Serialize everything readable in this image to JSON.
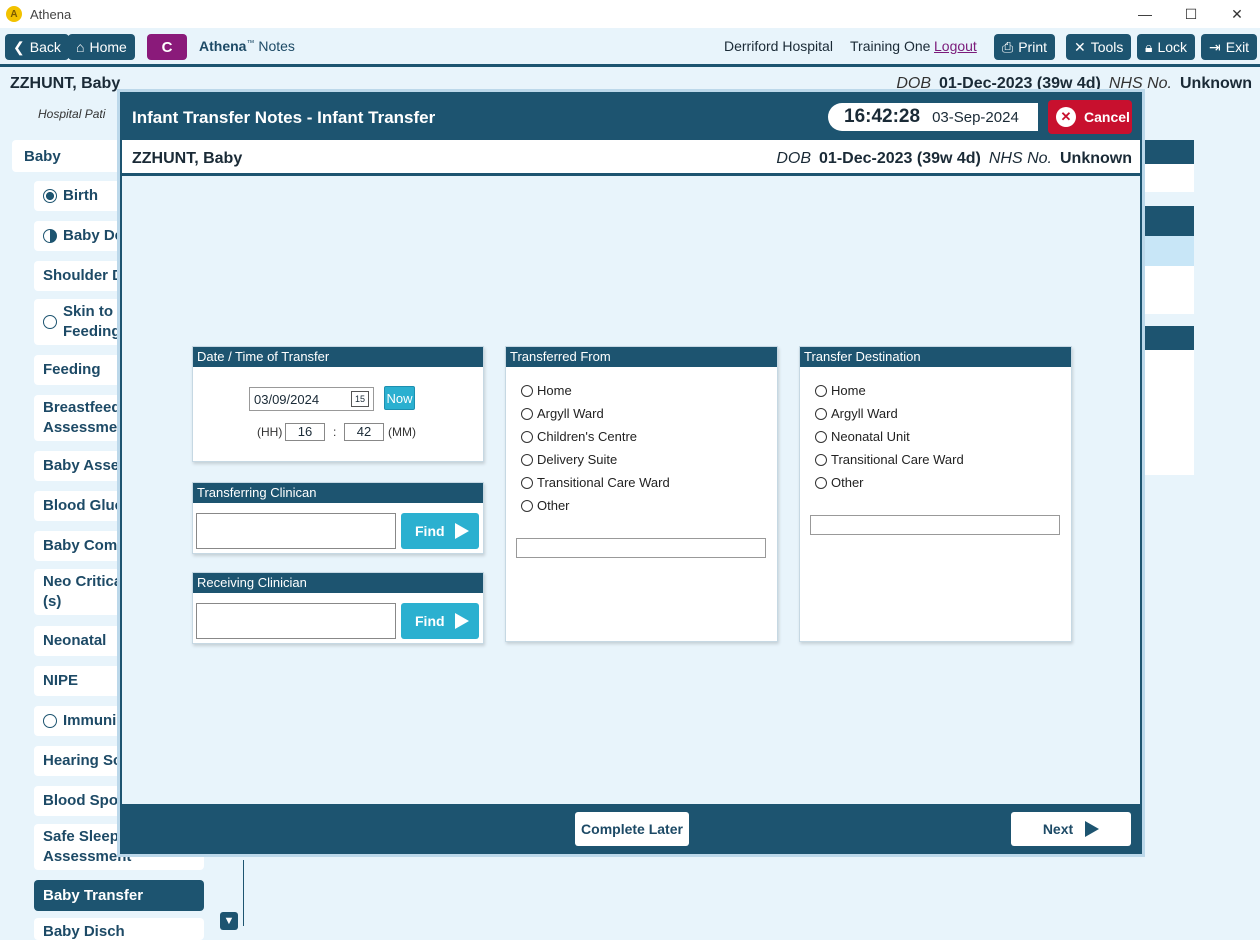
{
  "window": {
    "app_title": "Athena",
    "logo_letter": "A",
    "minimize": "—",
    "maximize": "☐",
    "close": "✕"
  },
  "toolbar": {
    "back": "Back",
    "home": "Home",
    "c_badge": "C",
    "brand": "Athena",
    "brand_tm": "™",
    "brand_suffix": " Notes",
    "hospital": "Derriford Hospital",
    "user": "Training One",
    "logout": "Logout",
    "print": "Print",
    "tools": "Tools",
    "lock": "Lock",
    "exit": "Exit"
  },
  "patient": {
    "name": "ZZHUNT, Baby",
    "dob_label": "DOB",
    "dob": "01-Dec-2023 (39w 4d)",
    "nhs_label": "NHS No.",
    "nhs": "Unknown"
  },
  "hospital_line": "Hospital Pati",
  "nav": {
    "header": "Baby",
    "items": [
      {
        "label": "Birth"
      },
      {
        "label": "Baby Det"
      },
      {
        "label": "Shoulder D"
      },
      {
        "label": "Skin to S\nFeeding"
      },
      {
        "label": "Feeding"
      },
      {
        "label": "Breastfeedi\nAssessmen"
      },
      {
        "label": "Baby Asses"
      },
      {
        "label": "Blood Gluc"
      },
      {
        "label": "Baby Comm"
      },
      {
        "label": "Neo Critica\n(s)"
      },
      {
        "label": "Neonatal"
      },
      {
        "label": "NIPE"
      },
      {
        "label": "Immunis"
      },
      {
        "label": "Hearing Sc"
      },
      {
        "label": "Blood Spot"
      },
      {
        "label": "Safe Sleepi\nAssessment"
      },
      {
        "label": "Baby Transfer"
      },
      {
        "label": "Baby Disch"
      }
    ]
  },
  "modal": {
    "title": "Infant Transfer Notes - Infant Transfer",
    "time": "16:42:28",
    "date": "03-Sep-2024",
    "cancel": "Cancel",
    "date_panel": {
      "title": "Date / Time of Transfer",
      "date_value": "03/09/2024",
      "cal_icon_text": "15",
      "now": "Now",
      "hh_label": "(HH)",
      "hh": "16",
      "sep": ":",
      "mm": "42",
      "mm_label": "(MM)"
    },
    "transferring": {
      "title": "Transferring Clinican",
      "find": "Find"
    },
    "receiving": {
      "title": "Receiving Clinician",
      "find": "Find"
    },
    "from": {
      "title": "Transferred From",
      "options": [
        "Home",
        "Argyll Ward",
        "Children's Centre",
        "Delivery Suite",
        "Transitional Care Ward",
        "Other"
      ]
    },
    "destination": {
      "title": "Transfer Destination",
      "options": [
        "Home",
        "Argyll Ward",
        "Neonatal Unit",
        "Transitional Care Ward",
        "Other"
      ]
    },
    "complete_later": "Complete Later",
    "next": "Next"
  },
  "colors": {
    "primary": "#1d5470",
    "accent": "#2bb0d0",
    "danger": "#c8102e",
    "badge": "#8a1a7a",
    "background": "#e8f4fb"
  }
}
